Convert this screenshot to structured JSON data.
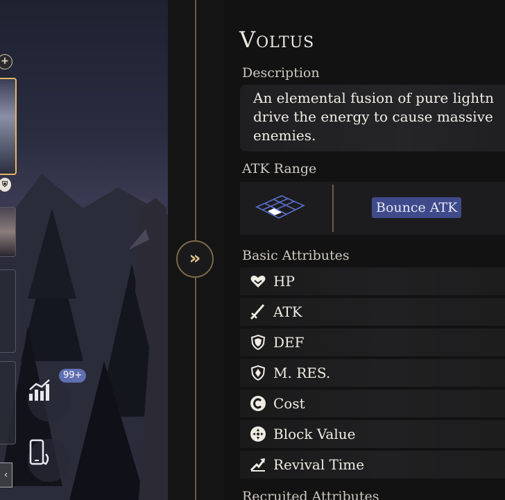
{
  "operator": {
    "name": "Voltus",
    "description_label": "Description",
    "description": "An elemental fusion of pure lightn\ndrive the energy to cause massive\nenemies."
  },
  "atk_range": {
    "label": "ATK Range",
    "tag": "Bounce ATK"
  },
  "basic_attributes": {
    "label": "Basic Attributes",
    "items": [
      {
        "label": "HP",
        "icon": "heart-icon"
      },
      {
        "label": "ATK",
        "icon": "sword-icon"
      },
      {
        "label": "DEF",
        "icon": "shield-icon"
      },
      {
        "label": "M. RES.",
        "icon": "magic-shield-icon"
      },
      {
        "label": "Cost",
        "icon": "cost-icon"
      },
      {
        "label": "Block Value",
        "icon": "block-icon"
      },
      {
        "label": "Revival Time",
        "icon": "revival-icon"
      }
    ]
  },
  "next_section_label": "Recruited Attributes",
  "sidebar": {
    "badge": "99+",
    "plus": "+",
    "back": "‹",
    "expand": "»"
  },
  "colors": {
    "accent_gold": "#e4b869",
    "tag_blue": "#3f4a8a",
    "badge_blue": "#5f6fb0"
  }
}
